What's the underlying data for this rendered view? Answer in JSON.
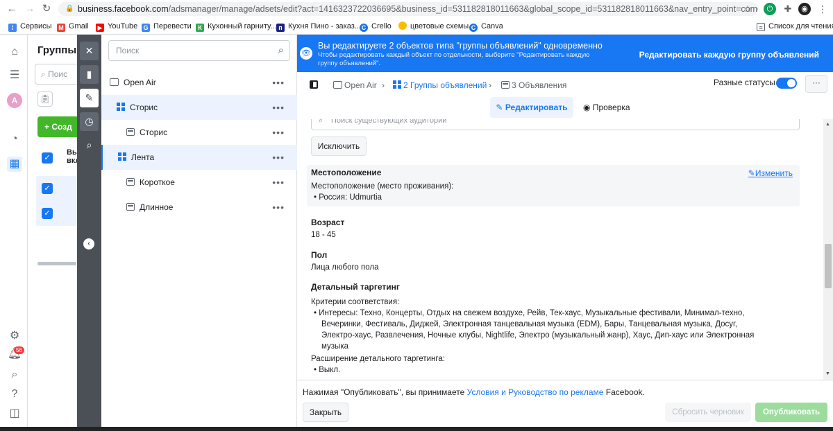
{
  "browser": {
    "url_host": "business.facebook.com",
    "url_path": "/adsmanager/manage/adsets/edit?act=1416323722036695&business_id=531182818011663&global_scope_id=531182818011663&nav_entry_point=comet_bookmark&col...",
    "bookmarks": [
      {
        "label": "Сервисы",
        "color": "#4285f4",
        "icon": "apps-icon"
      },
      {
        "label": "Gmail",
        "color": "#ea4335",
        "icon": "gmail-icon"
      },
      {
        "label": "YouTube",
        "color": "#ff0000",
        "icon": "youtube-icon"
      },
      {
        "label": "Перевести",
        "color": "#4285f4",
        "icon": "translate-icon"
      },
      {
        "label": "Кухонный гарниту...",
        "color": "#34a853",
        "icon": "kitchen-icon"
      },
      {
        "label": "Кухня Пино - заказ...",
        "color": "#1a237e",
        "icon": "pino-icon"
      },
      {
        "label": "Crello",
        "color": "#1a73e8",
        "icon": "crello-icon"
      },
      {
        "label": "цветовые схемы",
        "color": "#fbbc05",
        "icon": "color-icon"
      },
      {
        "label": "Canva",
        "color": "#1a73e8",
        "icon": "canva-icon"
      }
    ],
    "reading_list": "Список для чтения"
  },
  "global_nav": {
    "avatar_letter": "A",
    "notifications_badge": "56"
  },
  "campaign_panel": {
    "title": "Группы",
    "search_placeholder": "Поис",
    "create_label": "+ Созд",
    "col_header": "Вы вкл"
  },
  "tree": {
    "search_placeholder": "Поиск",
    "items": [
      {
        "label": "Open Air",
        "type": "campaign",
        "selected": false,
        "indent": 0
      },
      {
        "label": "Сторис",
        "type": "adset",
        "selected": true,
        "indent": 1
      },
      {
        "label": "Сторис",
        "type": "ad",
        "selected": false,
        "indent": 2
      },
      {
        "label": "Лента",
        "type": "adset",
        "selected": true,
        "indent": 1
      },
      {
        "label": "Короткое",
        "type": "ad",
        "selected": false,
        "indent": 2
      },
      {
        "label": "Длинное",
        "type": "ad",
        "selected": false,
        "indent": 2
      }
    ]
  },
  "banner": {
    "title": "Вы редактируете 2 объектов типа \"группы объявлений\" одновременно",
    "subtitle": "Чтобы редактировать каждый объект по отдельности, выберите \"Редактировать каждую группу объявлений\".",
    "action": "Редактировать каждую группу объявлений"
  },
  "breadcrumbs": {
    "campaign": "Open Air",
    "adsets": "2 Группы объявлений",
    "ads": "3 Объявления",
    "status_label": "Разные статусы"
  },
  "tabs": {
    "edit": "Редактировать",
    "review": "Проверка"
  },
  "form": {
    "audience_placeholder": "Поиск существующих аудиторий",
    "exclude_label": "Исключить",
    "location": {
      "heading": "Местоположение",
      "edit_link": "Изменить",
      "sub": "Местоположение (место проживания):",
      "value": "Россия: Udmurtia"
    },
    "age": {
      "heading": "Возраст",
      "value": "18 - 45"
    },
    "gender": {
      "heading": "Пол",
      "value": "Лица любого пола"
    },
    "detailed": {
      "heading": "Детальный таргетинг",
      "criteria": "Критерии соответствия:",
      "interests_line1": "Интересы: Техно, Концерты, Отдых на свежем воздухе, Рейв, Тек-хаус, Музыкальные фестивали, Минимал-техно,",
      "interests_line2": "Вечеринки, Фестиваль, Диджей, Электронная танцевальная музыка (EDM), Бары, Танцевальная музыка, Досуг,",
      "interests_line3": "Электро-хаус, Развлечения, Ночные клубы, Nightlife, Электро (музыкальный жанр), Хаус, Дип-хаус или Электронная",
      "interests_line4": "музыка",
      "expansion": "Расширение детального таргетинга:",
      "expansion_value": "Выкл."
    }
  },
  "footer": {
    "terms_prefix": "Нажимая \"Опубликовать\", вы принимаете ",
    "terms_link": "Условия и Руководство по рекламе",
    "terms_suffix": " Facebook.",
    "close": "Закрыть",
    "reset": "Сбросить черновик",
    "publish": "Опубликовать"
  }
}
